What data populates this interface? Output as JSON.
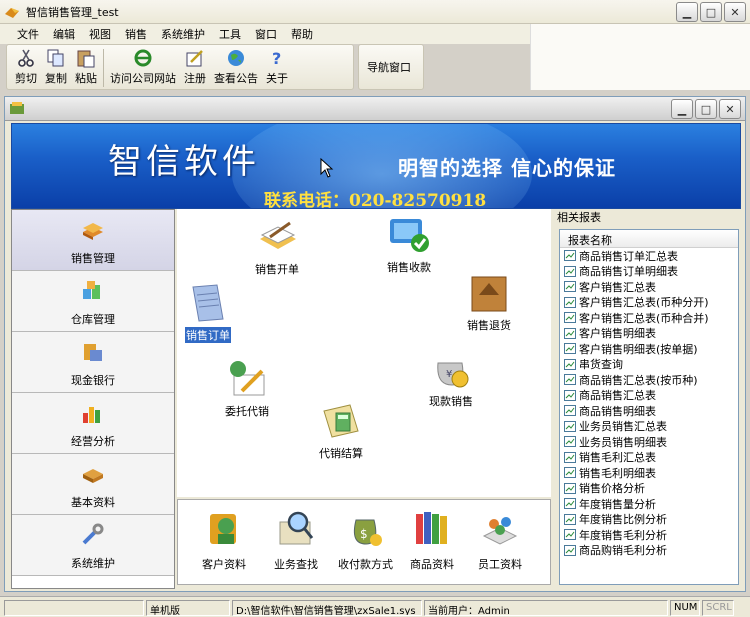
{
  "window": {
    "title": "智信销售管理_test"
  },
  "menu": [
    "文件",
    "编辑",
    "视图",
    "销售",
    "系统维护",
    "工具",
    "窗口",
    "帮助"
  ],
  "toolbar": {
    "buttons": [
      {
        "label": "剪切",
        "icon": "scissors-icon"
      },
      {
        "label": "复制",
        "icon": "copy-icon"
      },
      {
        "label": "粘贴",
        "icon": "paste-icon"
      },
      {
        "label": "访问公司网站",
        "icon": "ie-browser-icon"
      },
      {
        "label": "注册",
        "icon": "register-icon"
      },
      {
        "label": "查看公告",
        "icon": "globe-icon"
      },
      {
        "label": "关于",
        "icon": "help-icon"
      }
    ],
    "nav_label": "导航窗口"
  },
  "banner": {
    "brand": "智信软件",
    "slogan": "明智的选择 信心的保证",
    "phone": "联系电话：020-82570918"
  },
  "sidebar": {
    "items": [
      {
        "label": "销售管理",
        "icon": "books-icon",
        "selected": true
      },
      {
        "label": "仓库管理",
        "icon": "warehouse-icon",
        "selected": false
      },
      {
        "label": "现金银行",
        "icon": "bank-icon",
        "selected": false
      },
      {
        "label": "经营分析",
        "icon": "analysis-chart-icon",
        "selected": false
      },
      {
        "label": "基本资料",
        "icon": "basic-data-icon",
        "selected": false
      },
      {
        "label": "系统维护",
        "icon": "tools-icon",
        "selected": false
      }
    ]
  },
  "center": {
    "items": [
      {
        "label": "销售开单",
        "icon": "sales-order-pad-icon"
      },
      {
        "label": "销售收款",
        "icon": "payment-check-icon"
      },
      {
        "label": "销售订单",
        "icon": "order-notebook-icon",
        "selected": true
      },
      {
        "label": "销售退货",
        "icon": "return-box-icon"
      },
      {
        "label": "委托代销",
        "icon": "consign-icon"
      },
      {
        "label": "现款销售",
        "icon": "cash-sale-icon"
      },
      {
        "label": "代销结算",
        "icon": "calculator-icon"
      }
    ]
  },
  "bottom": {
    "items": [
      {
        "label": "客户资料",
        "icon": "customer-icon"
      },
      {
        "label": "业务查找",
        "icon": "search-icon"
      },
      {
        "label": "收付款方式",
        "icon": "money-bag-icon"
      },
      {
        "label": "商品资料",
        "icon": "product-books-icon"
      },
      {
        "label": "员工资料",
        "icon": "employee-icon"
      }
    ]
  },
  "reports": {
    "title": "相关报表",
    "column": "报表名称",
    "items": [
      "商品销售订单汇总表",
      "商品销售订单明细表",
      "客户销售汇总表",
      "客户销售汇总表(币种分开)",
      "客户销售汇总表(币种合并)",
      "客户销售明细表",
      "客户销售明细表(按单据)",
      "串货查询",
      "商品销售汇总表(按币种)",
      "商品销售汇总表",
      "商品销售明细表",
      "业务员销售汇总表",
      "业务员销售明细表",
      "销售毛利汇总表",
      "销售毛利明细表",
      "销售价格分析",
      "年度销售量分析",
      "年度销售比例分析",
      "年度销售毛利分析",
      "商品购销毛利分析"
    ]
  },
  "status": {
    "mode": "单机版",
    "path": "D:\\智信软件\\智信销售管理\\zxSale1.sys",
    "user": "当前用户：Admin",
    "num": "NUM",
    "scrl": "SCRL"
  },
  "colors": {
    "banner": "#1a5fc8",
    "selection": "#316ac5",
    "phone": "#ffe040"
  }
}
